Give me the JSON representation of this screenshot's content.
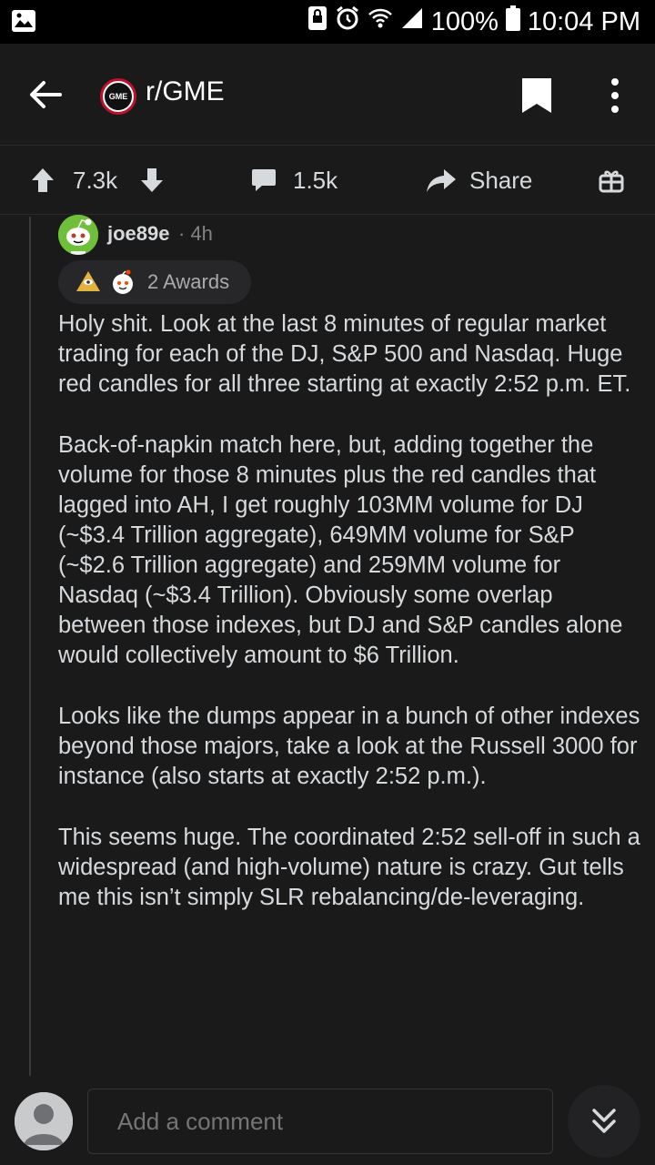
{
  "status_bar": {
    "battery": "100%",
    "time": "10:04 PM",
    "icons": [
      "image-icon",
      "tablet-lock-icon",
      "alarm-icon",
      "wifi-icon",
      "signal-icon",
      "battery-icon"
    ]
  },
  "header": {
    "subreddit_icon_text": "GME",
    "subreddit": "r/GME"
  },
  "actions": {
    "score": "7.3k",
    "comments": "1.5k",
    "share": "Share"
  },
  "comment": {
    "author": "joe89e",
    "meta": "· 4h",
    "awards": "2 Awards",
    "paragraphs": [
      "Holy shit. Look at the last 8 minutes of regular market trading for each of the DJ, S&P 500 and Nasdaq. Huge red candles for all three starting at exactly 2:52 p.m. ET.",
      "Back-of-napkin match here, but, adding together the volume for those 8 minutes plus the red candles that lagged into AH, I get roughly 103MM volume for DJ (~$3.4 Trillion aggregate), 649MM volume for S&P (~$2.6 Trillion aggregate) and 259MM volume for Nasdaq (~$3.4 Trillion). Obviously some overlap between those indexes, but DJ and S&P candles alone would collectively amount to $6 Trillion.",
      "Looks like the dumps appear in a bunch of other indexes beyond those majors, take a look at the Russell 3000 for instance (also starts at exactly 2:52 p.m.).",
      "This seems huge. The coordinated 2:52 sell-off in such a widespread (and high-volume) nature is crazy. Gut tells me this isn’t simply SLR rebalancing/de-leveraging."
    ]
  },
  "composer": {
    "placeholder": "Add a comment"
  }
}
